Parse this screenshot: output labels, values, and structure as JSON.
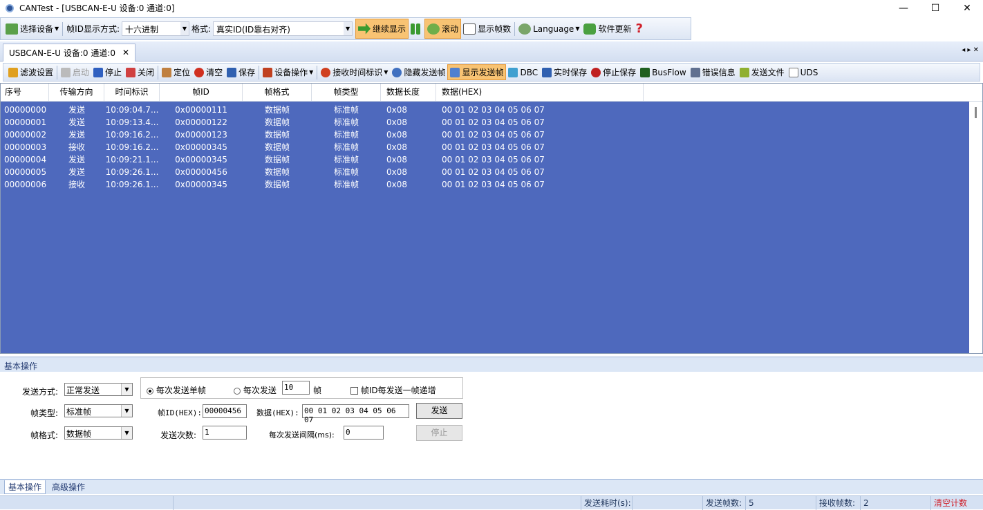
{
  "window": {
    "title": "CANTest  - [USBCAN-E-U 设备:0 通道:0]",
    "minimize": "—",
    "maximize": "☐",
    "close": "✕"
  },
  "toolbar1": {
    "select_device": "选择设备",
    "frame_id_display_label": "帧ID显示方式:",
    "frame_id_display_value": "十六进制",
    "format_label": "格式:",
    "format_value": "真实ID(ID靠右对齐)",
    "continue_display": "继续显示",
    "scroll": "滚动",
    "show_frame_count": "显示帧数",
    "language": "Language",
    "software_update": "软件更新"
  },
  "doc_tab": {
    "label": "USBCAN-E-U 设备:0 通道:0",
    "close": "✕",
    "nav": "◂ ▸ ✕"
  },
  "toolbar2": [
    "滤波设置",
    "启动",
    "停止",
    "关闭",
    "定位",
    "清空",
    "保存",
    "设备操作",
    "接收时间标识",
    "隐藏发送帧",
    "显示发送帧",
    "DBC",
    "实时保存",
    "停止保存",
    "BusFlow",
    "错误信息",
    "发送文件",
    "UDS"
  ],
  "grid": {
    "columns": [
      "序号",
      "传输方向",
      "时间标识",
      "帧ID",
      "帧格式",
      "帧类型",
      "数据长度",
      "数据(HEX)"
    ],
    "rows": [
      [
        "00000000",
        "发送",
        "10:09:04.7...",
        "0x00000111",
        "数据帧",
        "标准帧",
        "0x08",
        "00 01 02 03 04 05 06 07"
      ],
      [
        "00000001",
        "发送",
        "10:09:13.4...",
        "0x00000122",
        "数据帧",
        "标准帧",
        "0x08",
        "00 01 02 03 04 05 06 07"
      ],
      [
        "00000002",
        "发送",
        "10:09:16.2...",
        "0x00000123",
        "数据帧",
        "标准帧",
        "0x08",
        "00 01 02 03 04 05 06 07"
      ],
      [
        "00000003",
        "接收",
        "10:09:16.2...",
        "0x00000345",
        "数据帧",
        "标准帧",
        "0x08",
        "00 01 02 03 04 05 06 07"
      ],
      [
        "00000004",
        "发送",
        "10:09:21.1...",
        "0x00000345",
        "数据帧",
        "标准帧",
        "0x08",
        "00 01 02 03 04 05 06 07"
      ],
      [
        "00000005",
        "发送",
        "10:09:26.1...",
        "0x00000456",
        "数据帧",
        "标准帧",
        "0x08",
        "00 01 02 03 04 05 06 07"
      ],
      [
        "00000006",
        "接收",
        "10:09:26.1...",
        "0x00000345",
        "数据帧",
        "标准帧",
        "0x08",
        "00 01 02 03 04 05 06 07"
      ]
    ]
  },
  "basic": {
    "header": "基本操作",
    "send_mode_label": "发送方式:",
    "send_mode_value": "正常发送",
    "radio_single": "每次发送单帧",
    "radio_multi": "每次发送",
    "multi_count": "10",
    "frame_unit": "帧",
    "increment_label": "帧ID每发送一帧递增",
    "frame_type_label": "帧类型:",
    "frame_type_value": "标准帧",
    "frame_id_label": "帧ID(HEX):",
    "frame_id_value": "00000456",
    "data_label": "数据(HEX):",
    "data_value": "00 01 02 03 04 05 06 07",
    "send_button": "发送",
    "frame_format_label": "帧格式:",
    "frame_format_value": "数据帧",
    "send_times_label": "发送次数:",
    "send_times_value": "1",
    "interval_label": "每次发送间隔(ms):",
    "interval_value": "0",
    "stop_button": "停止"
  },
  "bottom_tabs": [
    "基本操作",
    "高级操作"
  ],
  "status": {
    "send_time_label": "发送耗时(s):",
    "send_frames_label": "发送帧数:",
    "send_frames_value": "5",
    "recv_frames_label": "接收帧数:",
    "recv_frames_value": "2",
    "clear_count": "清空计数"
  },
  "colors": {
    "grid_bg": "#4e69bd",
    "highlight": "#f8c373",
    "accent": "#d0202a"
  }
}
